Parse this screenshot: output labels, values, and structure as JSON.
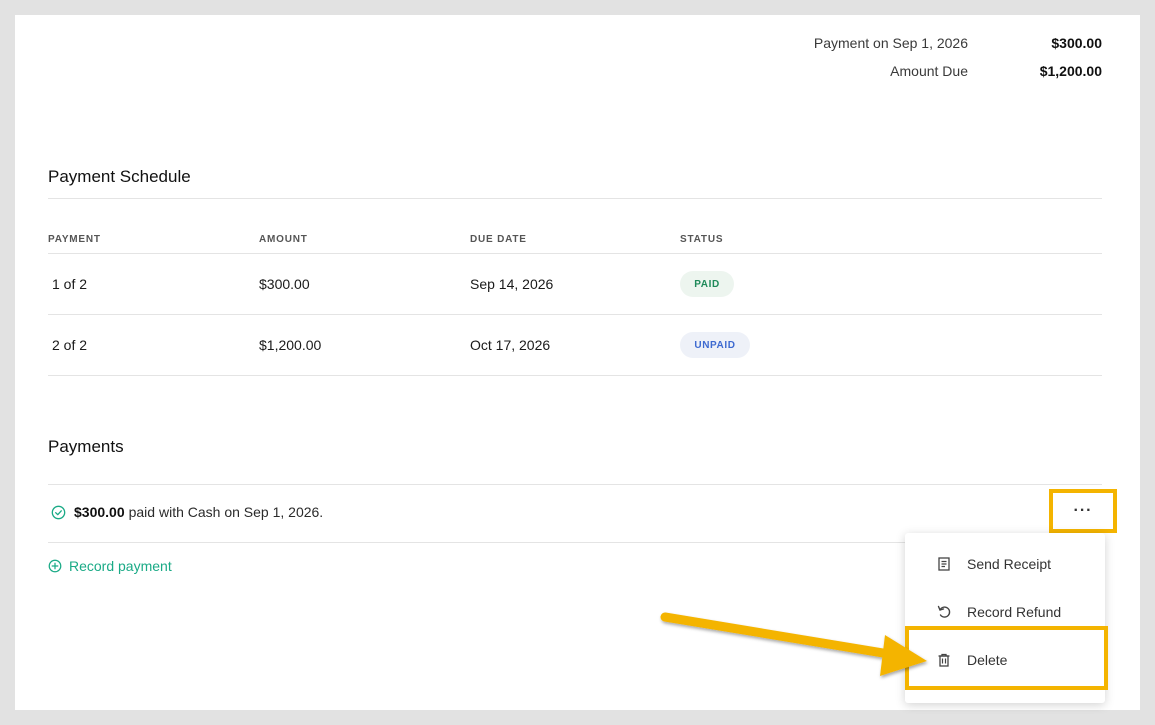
{
  "summary": {
    "payment_label": "Payment on Sep 1, 2026",
    "payment_value": "$300.00",
    "due_label": "Amount Due",
    "due_value": "$1,200.00"
  },
  "schedule": {
    "title": "Payment Schedule",
    "columns": [
      "PAYMENT",
      "AMOUNT",
      "DUE DATE",
      "STATUS"
    ],
    "rows": [
      {
        "payment": "1 of 2",
        "amount": "$300.00",
        "due": "Sep 14, 2026",
        "status": "PAID"
      },
      {
        "payment": "2 of 2",
        "amount": "$1,200.00",
        "due": "Oct 17, 2026",
        "status": "UNPAID"
      }
    ]
  },
  "payments": {
    "title": "Payments",
    "entry": {
      "amount": "$300.00",
      "text": "paid with Cash on Sep 1, 2026."
    },
    "record_label": "Record payment",
    "more_label": "···"
  },
  "menu": {
    "send_receipt": "Send Receipt",
    "record_refund": "Record Refund",
    "delete": "Delete"
  },
  "colors": {
    "accent": "#1aaa86",
    "highlight": "#f4b400",
    "paid": "#1f8a5a",
    "unpaid": "#3e6ad0"
  }
}
